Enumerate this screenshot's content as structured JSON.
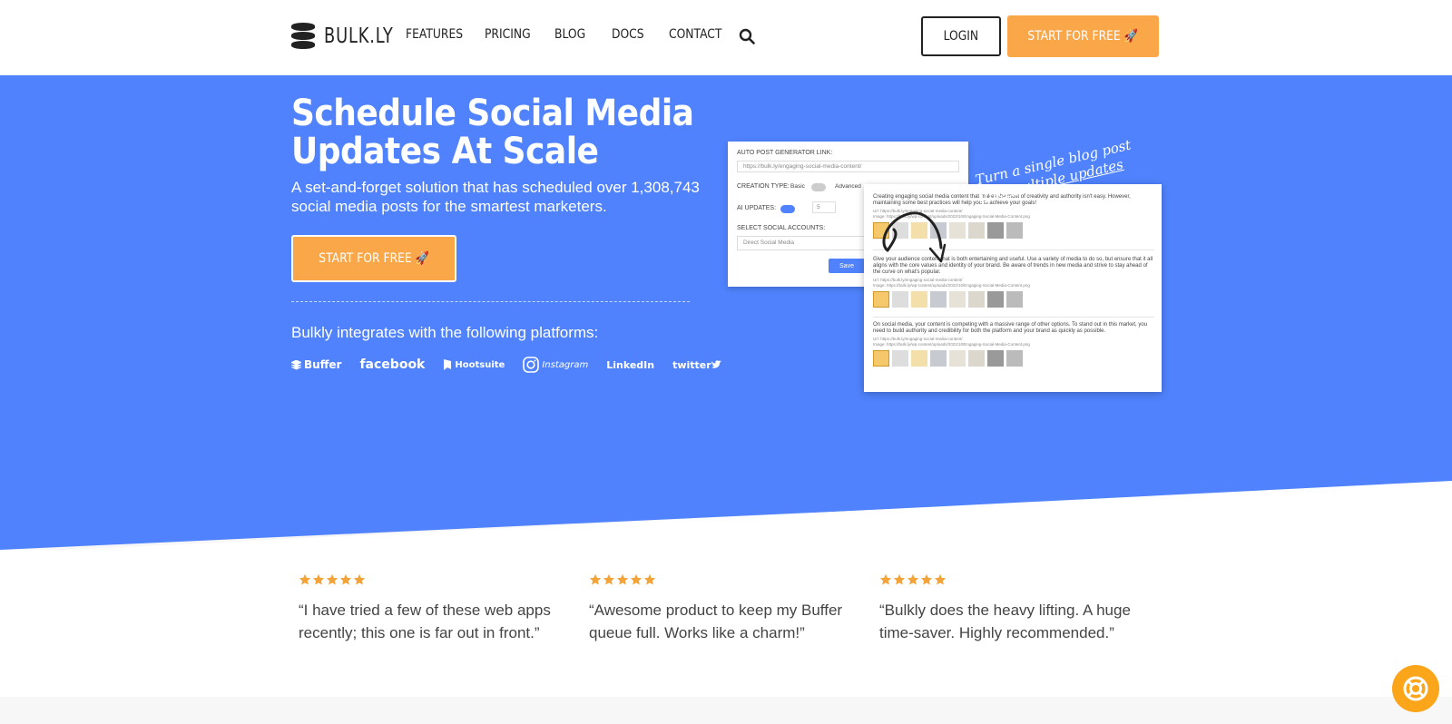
{
  "nav": {
    "logo_text": "BULK.LY",
    "links": [
      "FEATURES",
      "PRICING",
      "BLOG",
      "DOCS",
      "CONTACT"
    ],
    "login_label": "LOGIN",
    "cta_label": "START FOR FREE 🚀"
  },
  "hero": {
    "title": "Schedule Social Media Updates At Scale",
    "subtitle": "A set-and-forget solution that has scheduled over 1,308,743 social media posts for the smartest marketers.",
    "cta_label": "START FOR FREE 🚀",
    "integrates_text": "Bulkly integrates with the following platforms:",
    "platforms": [
      "Buffer",
      "facebook",
      "Hootsuite",
      "Instagram",
      "LinkedIn",
      "twitter"
    ],
    "note_line1": "Turn a single blog post",
    "note_line2": "into multiple updates"
  },
  "mock_form": {
    "link_label": "AUTO POST GENERATOR LINK:",
    "link_value": "https://bulk.ly/engaging-social-media-content/",
    "creation_label": "CREATION TYPE:",
    "basic_label": "Basic",
    "advanced_label": "Advanced",
    "ai_label": "AI UPDATES:",
    "ai_count": "5",
    "accounts_label": "SELECT SOCIAL ACCOUNTS:",
    "accounts_value": "Direct Social Media",
    "save_label": "Save"
  },
  "mock_posts": [
    {
      "text": "Creating engaging social media content that makes the most of creativity and authority isn't easy. However, maintaining some best practices will help you to achieve your goals!",
      "url": "Url: https://bulk.ly/engaging-social-media-content/",
      "image": "Image: https://bulk.ly/wp-content/uploads/2022/10/Engaging-Social-Media-Content.png"
    },
    {
      "text": "Give your audience content that is both entertaining and useful. Use a variety of media to do so, but ensure that it all aligns with the core values and identity of your brand. Be aware of trends in new media and strive to stay ahead of the curve on what's popular.",
      "url": "Url: https://bulk.ly/engaging-social-media-content/",
      "image": "Image: https://bulk.ly/wp-content/uploads/2022/10/Engaging-Social-Media-Content.png"
    },
    {
      "text": "On social media, your content is competing with a massive range of other options. To stand out in this market, you need to build authority and credibility for both the platform and your brand as quickly as possible.",
      "url": "Url: https://bulk.ly/engaging-social-media-content/",
      "image": "Image: https://bulk.ly/wp-content/uploads/2022/10/Engaging-Social-Media-Content.png"
    }
  ],
  "testimonials": [
    {
      "quote": "“I have tried a few of these web apps recently; this one is far out in front.”",
      "stars": 5
    },
    {
      "quote": "“Awesome product to keep my Buffer queue full. Works like a charm!”",
      "stars": 5
    },
    {
      "quote": "“Bulkly does the heavy lifting. A huge time-saver. Highly recommended.”",
      "stars": 5
    }
  ],
  "colors": {
    "hero_bg": "#4f82fc",
    "accent": "#faa74a",
    "star": "#f2a33a"
  },
  "icons": {
    "logo": "database-icon",
    "search": "search-icon",
    "help": "lifebuoy-icon"
  }
}
